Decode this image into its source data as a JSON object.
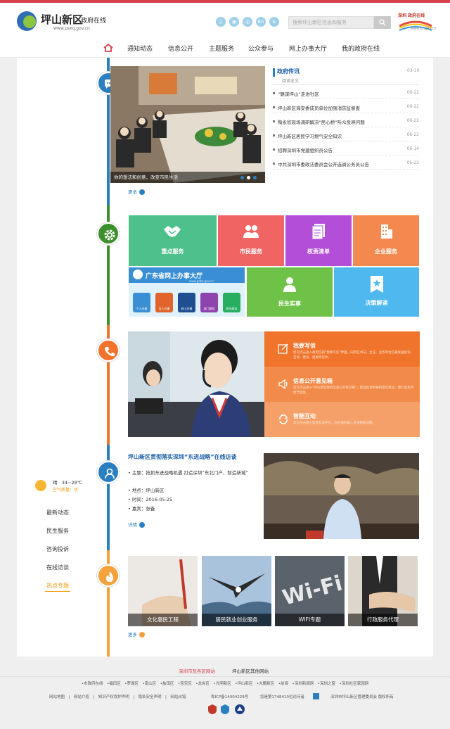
{
  "header": {
    "logo_title": "坪山新区",
    "logo_sub": "政府在线",
    "logo_url": "www.psxq.gov.cn",
    "search_placeholder": "搜索坪山新区信息和服务",
    "sz_logo_text": "深圳 政府在线",
    "sz_logo_sub": "Shenzhen Online",
    "sz_logo_url": "www.sz.gov.cn",
    "icons": [
      "phone-icon",
      "wechat-icon",
      "weibo-icon",
      "english-icon",
      "accessibility-icon"
    ]
  },
  "nav": {
    "items": [
      "通知动态",
      "信息公开",
      "主题服务",
      "公众参与",
      "网上办事大厅",
      "我的政府在线"
    ]
  },
  "news": {
    "photo_caption": "你的想法和创意，改变市民生活",
    "more": "更多",
    "first": {
      "title": "政府传讯",
      "read": "阅读全文",
      "date": "03-10"
    },
    "items": [
      {
        "title": "“魅谋坪山”走进社区",
        "date": "06-22"
      },
      {
        "title": "坪山新区海安委成员单位加强消防监督查",
        "date": "06-22"
      },
      {
        "title": "陶永欣现场调研解决“民心桥”听众反映问题",
        "date": "06-22"
      },
      {
        "title": "坪山新区居民学习燃气安全知识",
        "date": "06-22"
      },
      {
        "title": "招聘深圳市党建组织员公告",
        "date": "06-14"
      },
      {
        "title": "中共深圳市委政法委员会公开选调公务员公告",
        "date": "06-22"
      }
    ]
  },
  "services": {
    "tiles": [
      "重点服务",
      "市民服务",
      "权责清单",
      "企业服务",
      "民生实事",
      "决策解读"
    ],
    "banner_title": "广东省网上办事大厅",
    "banner_url": "www.gdbs.gov.cn",
    "banner_icons": [
      "个人办事",
      "法人办事",
      "网上办事",
      "部门服务",
      "阳光政务"
    ]
  },
  "interaction": {
    "blocks": [
      {
        "title": "我要写信",
        "desc": "您可点击进入政府信箱“我要写信”界面，向新区书记、主任、业务单位信箱发送投诉、咨询、建议、感谢等信件。"
      },
      {
        "title": "信息公开意见箱",
        "desc": "您可点击进入“坪山新区政府信息公开意见箱”，提出投诉举报和意见建议，我们会及时给予回复。"
      },
      {
        "title": "智能互动",
        "desc": "您可点击进入智能互动平台，向在线机器人咨询相关问题。"
      }
    ]
  },
  "visit": {
    "title": "坪山新区贯彻落实深圳“东进战略”在线访谈",
    "topic_label": "主题：",
    "topic": "抢抓东进战略机遇 打造深圳“东北门户、智造新城”",
    "place": "地点：坪山新区",
    "time": "时间：2016-05-25",
    "guest": "嘉宾：张备",
    "more": "详情"
  },
  "sidebar": {
    "weather": "晴",
    "temp": "34~28℃",
    "air": "空气质量：优",
    "links": [
      "最新动态",
      "民生服务",
      "咨询投诉",
      "在线访谈",
      "热点专题"
    ],
    "active": 4
  },
  "specials": {
    "items": [
      "文化惠民工程",
      "居民就业创业服务",
      "WIFI专题",
      "行政服务代理"
    ],
    "more": "更多"
  },
  "footer": {
    "tab_left": "深圳市及各区网站",
    "tab_right": "坪山新区其他网站",
    "sites": "•市政府在线　•福田区　•罗湖区　•南山区　•盐田区　•宝安区　•龙岗区　•光明新区　•坪山新区　•大鹏新区　•前海　•深圳新闻网　•深圳之窗　•深圳社区家园网",
    "links": "网站地图　|　网站介绍　|　知识产权保护声明　|　隐私安全声明　|　网站纠错",
    "icp": "粤ICP备14004229号",
    "visits": "您是第1748410位访问者",
    "copyright": "深圳市坪山新区管理委员会 版权所有"
  },
  "colors": {
    "accent_red": "#d6424f",
    "timeline_blue": "#2a7fc1",
    "timeline_green": "#3c8f2d",
    "timeline_orange": "#f0742c",
    "timeline_lightorange": "#f5a13c"
  }
}
